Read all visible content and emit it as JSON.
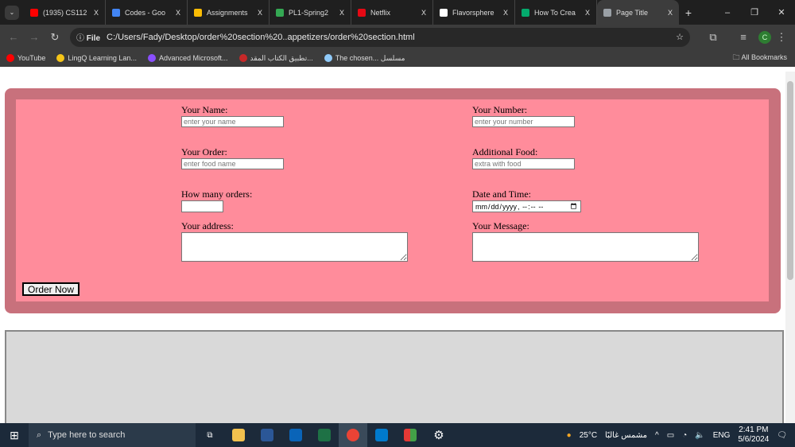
{
  "browser": {
    "tabs": [
      {
        "title": "(1935) CS112",
        "color": "#ff0000"
      },
      {
        "title": "Codes - Goo",
        "color": "#4285f4"
      },
      {
        "title": "Assignments",
        "color": "#fbbc04"
      },
      {
        "title": "PL1-Spring2",
        "color": "#34a853"
      },
      {
        "title": "Netflix",
        "color": "#e50914"
      },
      {
        "title": "Flavorsphere",
        "color": "#ffffff"
      },
      {
        "title": "How To Crea",
        "color": "#04aa6d"
      },
      {
        "title": "Page Title",
        "color": "#9aa0a6",
        "active": true
      }
    ],
    "new_tab": "+",
    "close": "X",
    "url_chip": "File",
    "url": "C:/Users/Fady/Desktop/order%20section%20..appetizers/order%20section.html",
    "profile": "C",
    "bookmarks": [
      {
        "label": "YouTube",
        "color": "#ff0000"
      },
      {
        "label": "LingQ Learning Lan...",
        "color": "#f5c518"
      },
      {
        "label": "Advanced Microsoft...",
        "color": "#8a4fff"
      },
      {
        "label": "تطبيق الكتاب المقد...",
        "color": "#c62828"
      },
      {
        "label": "The chosen... مسلسل",
        "color": "#90caf9"
      }
    ],
    "all_bookmarks": "All Bookmarks"
  },
  "form": {
    "name_label": "Your Name:",
    "name_placeholder": "enter your name",
    "number_label": "Your Number:",
    "number_placeholder": "enter your number",
    "order_label": "Your Order:",
    "order_placeholder": "enter food name",
    "additional_label": "Additional Food:",
    "additional_placeholder": "extra with food",
    "count_label": "How many orders:",
    "datetime_label": "Date and Time:",
    "address_label": "Your address:",
    "message_label": "Your Message:",
    "submit": "Order Now"
  },
  "taskbar": {
    "search": "Type here to search",
    "weather": "25°C",
    "weather_text": "مشمس غالبًا",
    "lang": "ENG",
    "time": "2:41 PM",
    "date": "5/6/2024"
  }
}
